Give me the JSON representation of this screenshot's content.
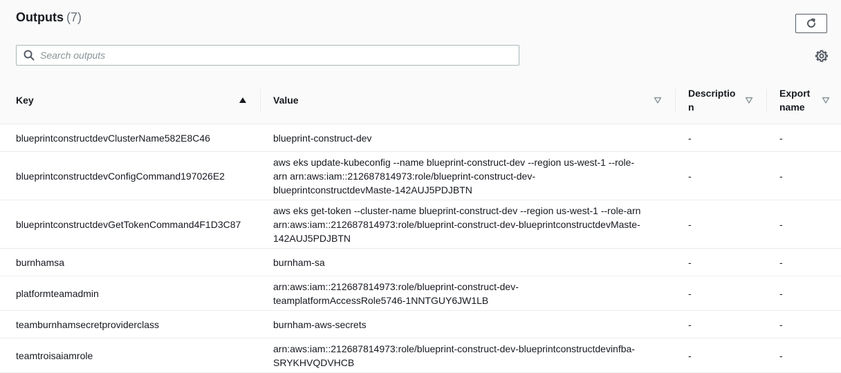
{
  "header": {
    "title": "Outputs",
    "count": "(7)",
    "refresh_icon": "refresh-icon",
    "settings_icon": "gear-icon"
  },
  "search": {
    "placeholder": "Search outputs",
    "value": ""
  },
  "table": {
    "columns": [
      {
        "label": "Key",
        "sort": "ascending"
      },
      {
        "label": "Value",
        "sort": "none"
      },
      {
        "label": "Description",
        "sort": "none"
      },
      {
        "label": "Export name",
        "sort": "none"
      }
    ],
    "column_labels_wrapped": {
      "description_line1": "Descriptio",
      "description_line2": "n",
      "export_line1": "Export",
      "export_line2": "name"
    },
    "rows": [
      {
        "key": "blueprintconstructdevClusterName582E8C46",
        "value_lines": [
          "blueprint-construct-dev"
        ],
        "description": "-",
        "export_name": "-"
      },
      {
        "key": "blueprintconstructdevConfigCommand197026E2",
        "value_lines": [
          "aws eks update-kubeconfig --name blueprint-construct-dev --region us-west-1 --role-",
          "arn arn:aws:iam::212687814973:role/blueprint-construct-dev-",
          "blueprintconstructdevMaste-142AUJ5PDJBTN"
        ],
        "description": "-",
        "export_name": "-"
      },
      {
        "key": "blueprintconstructdevGetTokenCommand4F1D3C87",
        "value_lines": [
          "aws eks get-token --cluster-name blueprint-construct-dev --region us-west-1 --role-arn",
          "arn:aws:iam::212687814973:role/blueprint-construct-dev-blueprintconstructdevMaste-",
          "142AUJ5PDJBTN"
        ],
        "description": "-",
        "export_name": "-"
      },
      {
        "key": "burnhamsa",
        "value_lines": [
          "burnham-sa"
        ],
        "description": "-",
        "export_name": "-"
      },
      {
        "key": "platformteamadmin",
        "value_lines": [
          "arn:aws:iam::212687814973:role/blueprint-construct-dev-",
          "teamplatformAccessRole5746-1NNTGUY6JW1LB"
        ],
        "description": "-",
        "export_name": "-"
      },
      {
        "key": "teamburnhamsecretproviderclass",
        "value_lines": [
          "burnham-aws-secrets"
        ],
        "description": "-",
        "export_name": "-"
      },
      {
        "key": "teamtroisaiamrole",
        "value_lines": [
          "arn:aws:iam::212687814973:role/blueprint-construct-dev-blueprintconstructdevinfba-",
          "SRYKHVQDVHCB"
        ],
        "description": "-",
        "export_name": "-"
      }
    ]
  }
}
